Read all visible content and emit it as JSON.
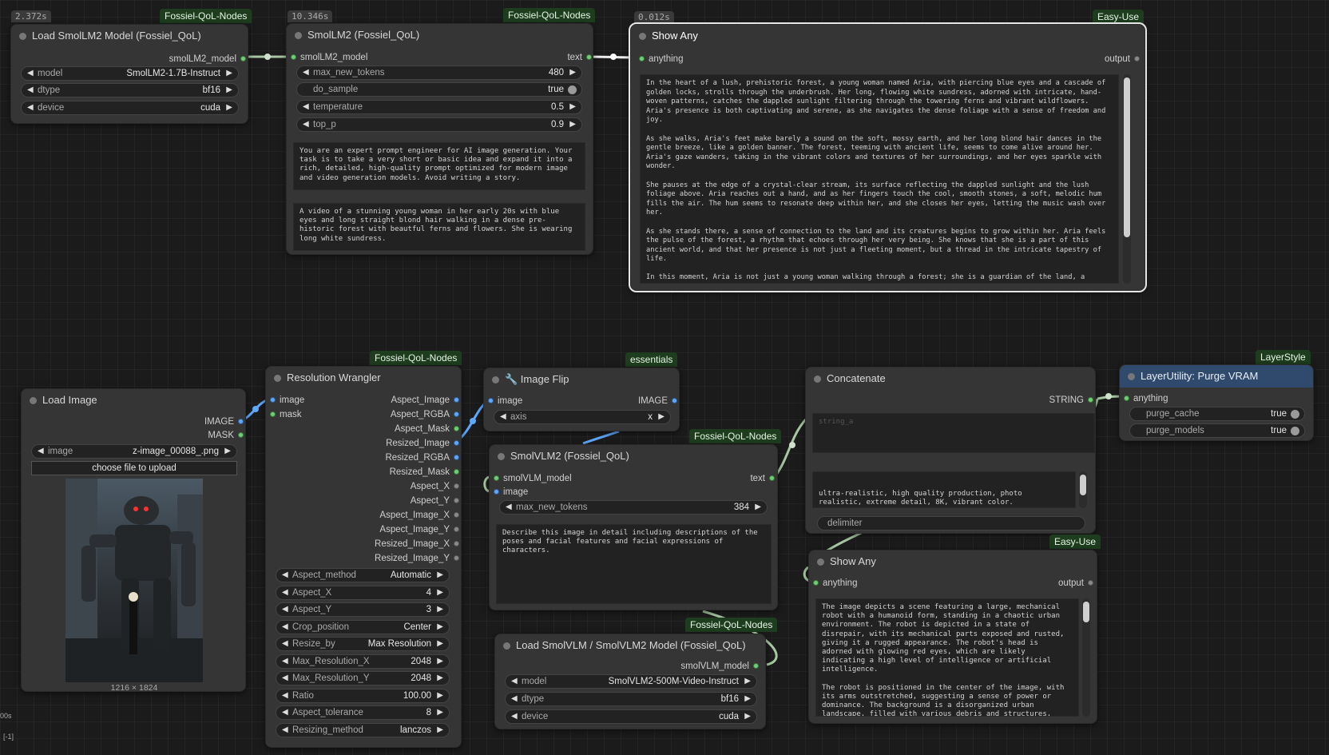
{
  "colors": {
    "badge_bg": "#1e3d1e",
    "link_green": "#a8c7a3",
    "link_blue": "#5fa8ff",
    "purge_header": "#2f4a6d"
  },
  "nodes": {
    "load_smollm2": {
      "badge": "Fossiel-QoL-Nodes",
      "timer": "2.372s",
      "title": "Load SmolLM2 Model (Fossiel_QoL)",
      "output": "smolLM2_model",
      "widgets": [
        {
          "label": "model",
          "value": "SmolLM2-1.7B-Instruct"
        },
        {
          "label": "dtype",
          "value": "bf16"
        },
        {
          "label": "device",
          "value": "cuda"
        }
      ]
    },
    "smollm2": {
      "badge": "Fossiel-QoL-Nodes",
      "timer": "10.346s",
      "title": "SmolLM2 (Fossiel_QoL)",
      "input": "smolLM2_model",
      "output": "text",
      "widgets": [
        {
          "label": "max_new_tokens",
          "value": "480"
        },
        {
          "label": "do_sample",
          "value": "true"
        },
        {
          "label": "temperature",
          "value": "0.5"
        },
        {
          "label": "top_p",
          "value": "0.9"
        }
      ],
      "system_prompt": "You are an expert prompt engineer for AI image generation. Your task is to take a very short or basic idea and expand it into a rich, detailed, high-quality prompt optimized for modern image and video generation models. Avoid writing a story.",
      "user_prompt": "A video of a stunning young woman in her early 20s with blue eyes and long straight blond hair walking in a dense pre-historic forest with beautful ferns and flowers. She is wearing long white sundress."
    },
    "show_any_top": {
      "badge": "Easy-Use",
      "timer": "0.012s",
      "title": "Show Any",
      "input": "anything",
      "output": "output",
      "text": "In the heart of a lush, prehistoric forest, a young woman named Aria, with piercing blue eyes and a cascade of golden locks, strolls through the underbrush. Her long, flowing white sundress, adorned with intricate, hand-woven patterns, catches the dappled sunlight filtering through the towering ferns and vibrant wildflowers. Aria's presence is both captivating and serene, as she navigates the dense foliage with a sense of freedom and joy.\n\nAs she walks, Aria's feet make barely a sound on the soft, mossy earth, and her long blond hair dances in the gentle breeze, like a golden banner. The forest, teeming with ancient life, seems to come alive around her. Aria's gaze wanders, taking in the vibrant colors and textures of her surroundings, and her eyes sparkle with wonder.\n\nShe pauses at the edge of a crystal-clear stream, its surface reflecting the dappled sunlight and the lush foliage above. Aria reaches out a hand, and as her fingers touch the cool, smooth stones, a soft, melodic hum fills the air. The hum seems to resonate deep within her, and she closes her eyes, letting the music wash over her.\n\nAs she stands there, a sense of connection to the land and its creatures begins to grow within her. Aria feels the pulse of the forest, a rhythm that echoes through her very being. She knows that she is a part of this ancient world, and that her presence is not just a fleeting moment, but a thread in the intricate tapestry of life.\n\nIn this moment, Aria is not just a young woman walking through a forest; she is a guardian of the land, a"
    },
    "load_image": {
      "title": "Load Image",
      "outputs": [
        "IMAGE",
        "MASK"
      ],
      "widget": {
        "label": "image",
        "value": "z-image_00088_.png"
      },
      "upload_button": "choose file to upload",
      "caption": "1216 × 1824"
    },
    "resolution_wrangler": {
      "badge": "Fossiel-QoL-Nodes",
      "title": "Resolution Wrangler",
      "inputs": [
        "image",
        "mask"
      ],
      "outputs": [
        "Aspect_Image",
        "Aspect_RGBA",
        "Aspect_Mask",
        "Resized_Image",
        "Resized_RGBA",
        "Resized_Mask",
        "Aspect_X",
        "Aspect_Y",
        "Aspect_Image_X",
        "Aspect_Image_Y",
        "Resized_Image_X",
        "Resized_Image_Y"
      ],
      "widgets": [
        {
          "label": "Aspect_method",
          "value": "Automatic"
        },
        {
          "label": "Aspect_X",
          "value": "4"
        },
        {
          "label": "Aspect_Y",
          "value": "3"
        },
        {
          "label": "Crop_position",
          "value": "Center"
        },
        {
          "label": "Resize_by",
          "value": "Max Resolution"
        },
        {
          "label": "Max_Resolution_X",
          "value": "2048"
        },
        {
          "label": "Max_Resolution_Y",
          "value": "2048"
        },
        {
          "label": "Ratio",
          "value": "100.00"
        },
        {
          "label": "Aspect_tolerance",
          "value": "8"
        },
        {
          "label": "Resizing_method",
          "value": "lanczos"
        }
      ]
    },
    "image_flip": {
      "badge": "essentials",
      "title": "🔧 Image Flip",
      "input": "image",
      "output": "IMAGE",
      "widget": {
        "label": "axis",
        "value": "x"
      }
    },
    "smolvlm2": {
      "badge": "Fossiel-QoL-Nodes",
      "title": "SmolVLM2 (Fossiel_QoL)",
      "inputs": [
        "smolVLM_model",
        "image"
      ],
      "output": "text",
      "widget": {
        "label": "max_new_tokens",
        "value": "384"
      },
      "prompt": "Describe this image in detail including descriptions of the poses and facial features and facial expressions of characters."
    },
    "load_smolvlm": {
      "badge": "Fossiel-QoL-Nodes",
      "title": "Load SmolVLM / SmolVLM2 Model (Fossiel_QoL)",
      "output": "smolVLM_model",
      "widgets": [
        {
          "label": "model",
          "value": "SmolVLM2-500M-Video-Instruct"
        },
        {
          "label": "dtype",
          "value": "bf16"
        },
        {
          "label": "device",
          "value": "cuda"
        }
      ]
    },
    "concatenate": {
      "title": "Concatenate",
      "output": "STRING",
      "placeholder": "string_a",
      "string_b": "ultra-realistic, high quality production, photo realistic, extreme detail, 8K, vibrant color.",
      "delimiter_label": "delimiter"
    },
    "show_any_bottom": {
      "badge": "Easy-Use",
      "title": "Show Any",
      "input": "anything",
      "output": "output",
      "text": "The image depicts a scene featuring a large, mechanical robot with a humanoid form, standing in a chaotic urban environment. The robot is depicted in a state of disrepair, with its mechanical parts exposed and rusted, giving it a rugged appearance. The robot's head is adorned with glowing red eyes, which are likely indicating a high level of intelligence or artificial intelligence.\n\nThe robot is positioned in the center of the image, with its arms outstretched, suggesting a sense of power or dominance. The background is a disorganized urban landscape, filled with various debris and structures,"
    },
    "purge_vram": {
      "badge": "LayerStyle",
      "title": "LayerUtility: Purge VRAM",
      "input": "anything",
      "widgets": [
        {
          "label": "purge_cache",
          "value": "true"
        },
        {
          "label": "purge_models",
          "value": "true"
        }
      ]
    }
  },
  "corner": {
    "top": "00s",
    "bottom": "[-1]"
  }
}
